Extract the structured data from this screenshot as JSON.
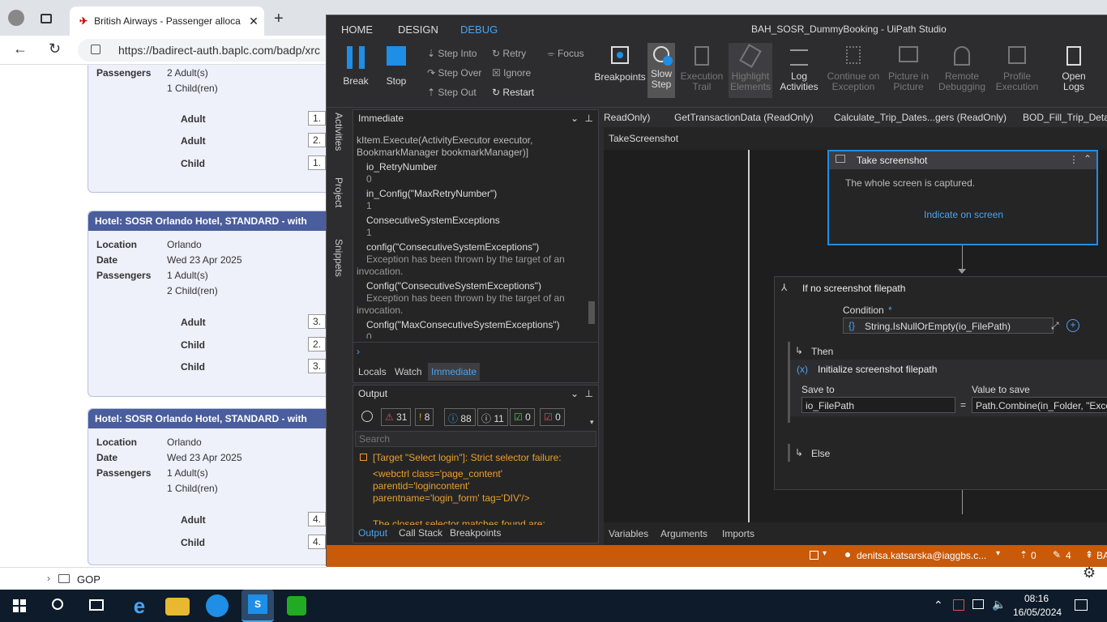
{
  "browser": {
    "tab_title": "British Airways - Passenger alloca",
    "url": "https://badirect-auth.baplc.com/badp/xrc",
    "top_card": {
      "passengers_label": "Passengers",
      "passengers_adults": "2 Adult(s)",
      "passengers_children": "1 Child(ren)",
      "rows": [
        {
          "label": "Adult",
          "box": "1."
        },
        {
          "label": "Adult",
          "box": "2."
        },
        {
          "label": "Child",
          "box": "1."
        }
      ]
    },
    "hotel_cards": [
      {
        "header": "Hotel: SOSR Orlando Hotel, STANDARD - with",
        "location_label": "Location",
        "location": "Orlando",
        "date_label": "Date",
        "date": "Wed 23 Apr 2025",
        "passengers_label": "Passengers",
        "adults": "1 Adult(s)",
        "children": "2 Child(ren)",
        "rows": [
          {
            "label": "Adult",
            "box": "3."
          },
          {
            "label": "Child",
            "box": "2."
          },
          {
            "label": "Child",
            "box": "3."
          }
        ]
      },
      {
        "header": "Hotel: SOSR Orlando Hotel, STANDARD - with",
        "location_label": "Location",
        "location": "Orlando",
        "date_label": "Date",
        "date": "Wed 23 Apr 2025",
        "passengers_label": "Passengers",
        "adults": "1 Adult(s)",
        "children": "1 Child(ren)",
        "rows": [
          {
            "label": "Adult",
            "box": "4."
          },
          {
            "label": "Child",
            "box": "4."
          }
        ]
      }
    ],
    "gop_label": "GOP"
  },
  "studio": {
    "menu": {
      "home": "HOME",
      "design": "DESIGN",
      "debug": "DEBUG"
    },
    "title": "BAH_SOSR_DummyBooking - UiPath Studio",
    "ribbon": {
      "break": "Break",
      "stop": "Stop",
      "step_into": "Step Into",
      "step_over": "Step Over",
      "step_out": "Step Out",
      "retry": "Retry",
      "ignore": "Ignore",
      "restart": "Restart",
      "focus": "Focus",
      "breakpoints": "Breakpoints",
      "slow_step_1": "Slow",
      "slow_step_2": "Step",
      "exec_trail_1": "Execution",
      "exec_trail_2": "Trail",
      "highlight_1": "Highlight",
      "highlight_2": "Elements",
      "log_1": "Log",
      "log_2": "Activities",
      "continue_1": "Continue on",
      "continue_2": "Exception",
      "pip_1": "Picture in",
      "pip_2": "Picture",
      "remote_1": "Remote",
      "remote_2": "Debugging",
      "profile_1": "Profile",
      "profile_2": "Execution",
      "openlogs_1": "Open",
      "openlogs_2": "Logs"
    },
    "side_tabs": {
      "activities": "Activities",
      "project": "Project",
      "snippets": "Snippets"
    },
    "immediate": {
      "title": "Immediate",
      "lines": [
        {
          "expr": "kItem.Execute(ActivityExecutor executor,",
          "res": ""
        },
        {
          "expr": "BookmarkManager bookmarkManager)]",
          "res": ""
        },
        {
          "expr": "io_RetryNumber",
          "res": "0"
        },
        {
          "expr": "in_Config(\"MaxRetryNumber\")",
          "res": "1"
        },
        {
          "expr": "ConsecutiveSystemExceptions",
          "res": "1"
        },
        {
          "expr": "config(\"ConsecutiveSystemExceptions\")",
          "res": "Exception has been thrown by the target of an",
          "res2": "invocation."
        },
        {
          "expr": "Config(\"ConsecutiveSystemExceptions\")",
          "res": "Exception has been thrown by the target of an",
          "res2": "invocation."
        },
        {
          "expr": "Config(\"MaxConsecutiveSystemExceptions\")",
          "res": "0"
        }
      ],
      "tabs": {
        "locals": "Locals",
        "watch": "Watch",
        "immediate": "Immediate"
      }
    },
    "output": {
      "title": "Output",
      "counts": {
        "errors": "31",
        "warnings": "8",
        "info": "88",
        "trace": "11",
        "verbose": "0",
        "fatal": "0"
      },
      "search_placeholder": "Search",
      "msg1": "[Target \"Select login\"]: Strict selector failure:",
      "msg2": "<webctrl class='page_content'",
      "msg3": "parentid='logincontent'",
      "msg4": "parentname='login_form' tag='DIV'/>",
      "msg5": "The closest selector matches found are:",
      "tabs": {
        "output": "Output",
        "callstack": "Call Stack",
        "breakpoints": "Breakpoints"
      }
    },
    "doc_tabs": [
      "ReadOnly)",
      "GetTransactionData (ReadOnly)",
      "Calculate_Trip_Dates...gers (ReadOnly)",
      "BOD_Fill_Trip_Detais"
    ],
    "breadcrumb": "TakeScreenshot",
    "take_screenshot": {
      "title": "Take screenshot",
      "desc": "The whole screen is captured.",
      "link": "Indicate on screen"
    },
    "if_block": {
      "title": "If no screenshot filepath",
      "condition_label": "Condition",
      "condition_value": "String.IsNullOrEmpty(io_FilePath)",
      "then": "Then",
      "init": "Initialize screenshot filepath",
      "save_to_label": "Save to",
      "value_label": "Value to save",
      "save_to_value": "io_FilePath",
      "value_value": "Path.Combine(in_Folder, \"Exce",
      "else": "Else"
    },
    "bottom_tabs": {
      "variables": "Variables",
      "arguments": "Arguments",
      "imports": "Imports"
    },
    "status": {
      "user": "denitsa.katsarska@iaggbs.c...",
      "publish_count": "0",
      "edit_count": "4",
      "extra": "BA"
    }
  },
  "taskbar": {
    "time": "08:16",
    "date": "16/05/2024"
  }
}
